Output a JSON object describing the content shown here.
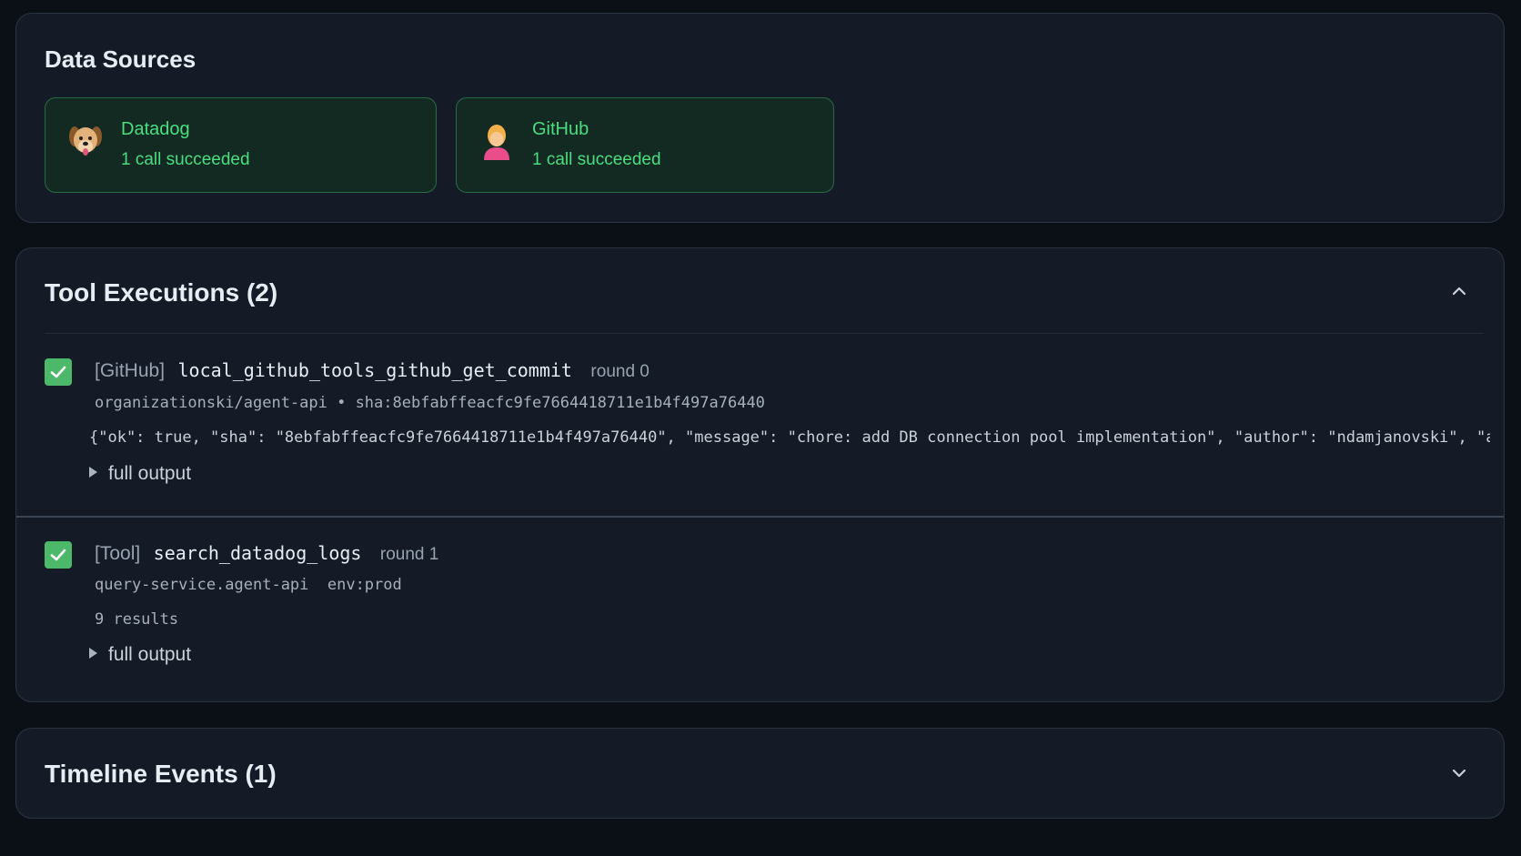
{
  "data_sources": {
    "title": "Data Sources",
    "cards": [
      {
        "name": "Datadog",
        "status": "1 call succeeded",
        "icon": "dog-face-icon"
      },
      {
        "name": "GitHub",
        "status": "1 call succeeded",
        "icon": "person-icon"
      }
    ]
  },
  "tool_executions": {
    "title": "Tool Executions (2)",
    "expanded": true,
    "items": [
      {
        "tag": "[GitHub]",
        "tool": "local_github_tools_github_get_commit",
        "round": "round 0",
        "meta": "organizationski/agent-api • sha:8ebfabffeacfc9fe7664418711e1b4f497a76440",
        "output_preview": "{\"ok\": true, \"sha\": \"8ebfabffeacfc9fe7664418711e1b4f497a76440\", \"message\": \"chore: add DB connection pool implementation\", \"author\": \"ndamjanovski\", \"author_ema",
        "toggle": "full output"
      },
      {
        "tag": "[Tool]",
        "tool": "search_datadog_logs",
        "round": "round 1",
        "meta": "query-service.agent-api  env:prod",
        "results": "9 results",
        "toggle": "full output"
      }
    ]
  },
  "timeline_events": {
    "title": "Timeline Events (1)",
    "expanded": false
  },
  "colors": {
    "success_green": "#4ade80",
    "check_green": "#4cb96a",
    "panel_bg": "#141b26",
    "page_bg": "#0b0f16"
  }
}
